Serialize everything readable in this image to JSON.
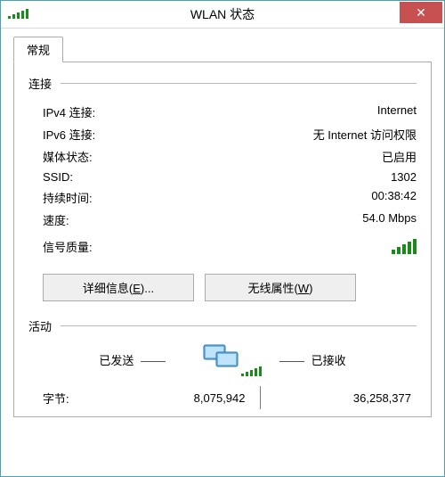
{
  "window": {
    "title": "WLAN 状态"
  },
  "tabs": {
    "general": "常规"
  },
  "sections": {
    "connection": "连接",
    "activity": "活动"
  },
  "conn": {
    "ipv4_label": "IPv4 连接:",
    "ipv4_value": "Internet",
    "ipv6_label": "IPv6 连接:",
    "ipv6_value": "无 Internet 访问权限",
    "media_label": "媒体状态:",
    "media_value": "已启用",
    "ssid_label": "SSID:",
    "ssid_value": "1302",
    "duration_label": "持续时间:",
    "duration_value": "00:38:42",
    "speed_label": "速度:",
    "speed_value": "54.0 Mbps",
    "signal_label": "信号质量:"
  },
  "buttons": {
    "details_pre": "详细信息(",
    "details_key": "E",
    "details_post": ")...",
    "wireless_pre": "无线属性(",
    "wireless_key": "W",
    "wireless_post": ")"
  },
  "activity": {
    "sent": "已发送",
    "received": "已接收",
    "bytes_label": "字节:",
    "bytes_sent": "8,075,942",
    "bytes_recv": "36,258,377"
  }
}
